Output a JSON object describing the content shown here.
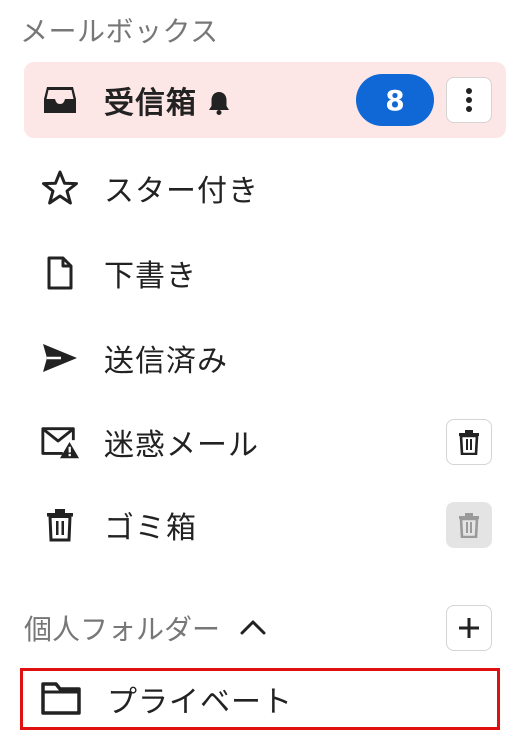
{
  "mailbox": {
    "title": "メールボックス",
    "items": [
      {
        "label": "受信箱",
        "icon": "inbox-icon",
        "badge": "8",
        "active": true
      },
      {
        "label": "スター付き",
        "icon": "star-icon"
      },
      {
        "label": "下書き",
        "icon": "draft-icon"
      },
      {
        "label": "送信済み",
        "icon": "send-icon"
      },
      {
        "label": "迷惑メール",
        "icon": "spam-icon"
      },
      {
        "label": "ゴミ箱",
        "icon": "trash-icon"
      }
    ]
  },
  "folders": {
    "title": "個人フォルダー",
    "items": [
      {
        "label": "プライベート",
        "icon": "folder-icon"
      }
    ]
  },
  "colors": {
    "active_bg": "#fde7e6",
    "badge_bg": "#1068d6",
    "highlight_border": "#e01010"
  }
}
